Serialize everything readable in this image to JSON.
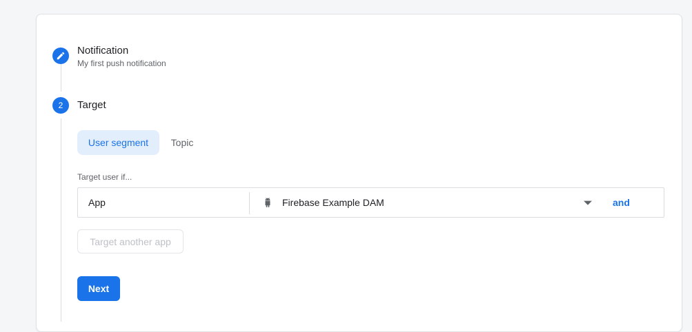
{
  "steps": [
    {
      "number_icon": "pencil-icon",
      "title": "Notification",
      "subtitle": "My first push notification"
    },
    {
      "number": "2",
      "title": "Target"
    }
  ],
  "target": {
    "tabs": [
      "User segment",
      "Topic"
    ],
    "active_tab": "User segment",
    "target_label": "Target user if...",
    "condition": {
      "field": "App",
      "app_icon": "android-icon",
      "value": "Firebase Example DAM",
      "dropdown_icon": "caret-down-icon",
      "conjunction": "and"
    },
    "add_app_label": "Target another app",
    "next_label": "Next"
  },
  "colors": {
    "accent": "#1a73e8",
    "accent_soft": "#e3eefc",
    "text": "#202124",
    "muted": "#5f6368"
  }
}
